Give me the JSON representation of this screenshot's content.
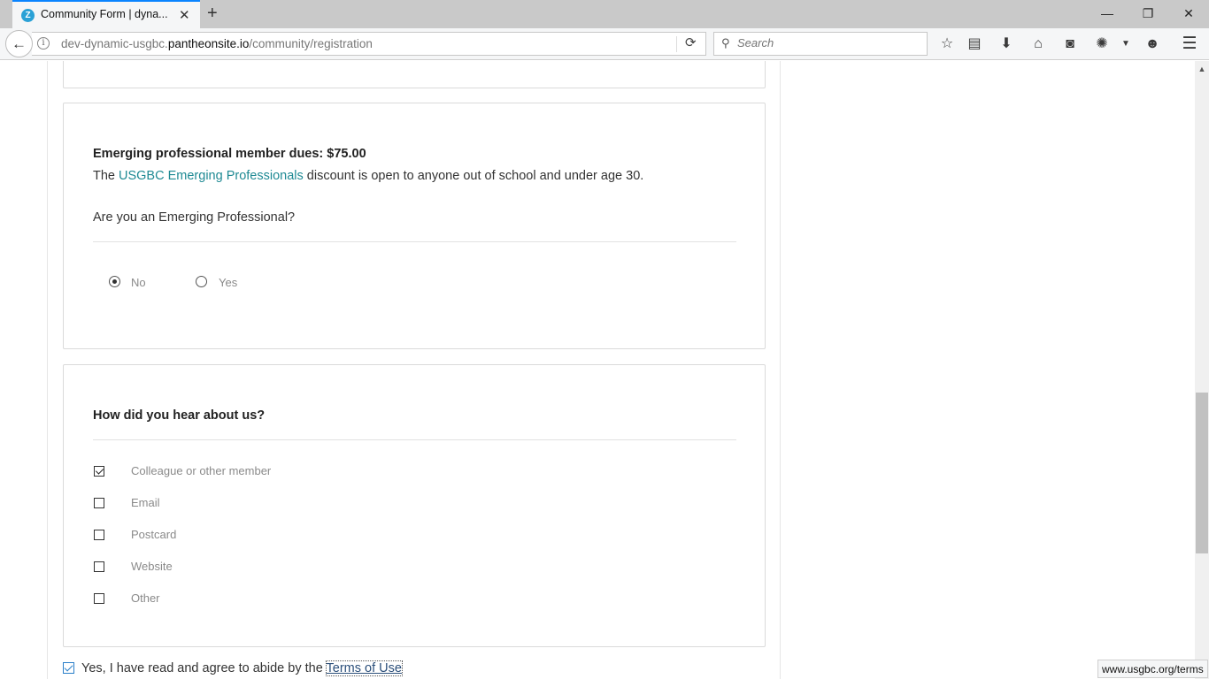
{
  "browser": {
    "tab_title": "Community Form | dyna...",
    "url_prefix": "dev-dynamic-usgbc.",
    "url_host": "pantheonsite.io",
    "url_path": "/community/registration",
    "search_placeholder": "Search",
    "status_url": "www.usgbc.org/terms",
    "icons": [
      "back-icon",
      "info-icon",
      "reload-icon",
      "search-icon",
      "bookmark-star-icon",
      "reading-list-icon",
      "download-icon",
      "home-icon",
      "pocket-icon",
      "extension-icon",
      "dropdown-arrow-icon",
      "smiley-icon",
      "menu-icon"
    ]
  },
  "dues": {
    "heading": "Emerging professional member dues: $75.00",
    "text_before": "The ",
    "link_text": "USGBC Emerging Professionals",
    "text_after": " discount is open to anyone out of school and under age 30.",
    "question": "Are you an Emerging Professional?",
    "options": [
      {
        "label": "No",
        "selected": true
      },
      {
        "label": "Yes",
        "selected": false
      }
    ]
  },
  "hear": {
    "heading": "How did you hear about us?",
    "options": [
      {
        "label": "Colleague or other member",
        "checked": true
      },
      {
        "label": "Email",
        "checked": false
      },
      {
        "label": "Postcard",
        "checked": false
      },
      {
        "label": "Website",
        "checked": false
      },
      {
        "label": "Other",
        "checked": false
      }
    ]
  },
  "agree": {
    "text": "Yes, I have read and agree to abide by the ",
    "link_text": "Terms of Use",
    "checked": true
  }
}
